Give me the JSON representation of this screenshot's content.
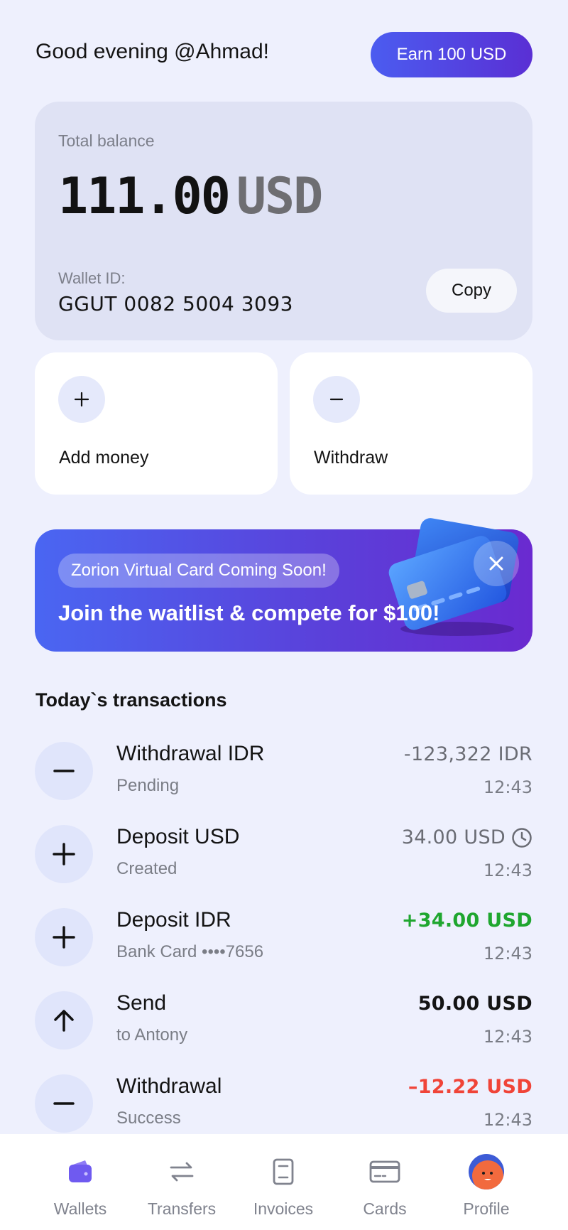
{
  "header": {
    "greeting": "Good evening @Ahmad!",
    "earn_button": "Earn 100 USD"
  },
  "balance": {
    "label": "Total balance",
    "amount": "111.00",
    "currency": "USD",
    "wallet_label": "Wallet ID:",
    "wallet_id": "GGUT 0082 5004 3093",
    "copy_button": "Copy"
  },
  "actions": [
    {
      "label": "Add money",
      "icon": "plus-icon"
    },
    {
      "label": "Withdraw",
      "icon": "minus-icon"
    }
  ],
  "promo": {
    "chip": "Zorion Virtual Card Coming Soon!",
    "title": "Join the waitlist & compete for $100!"
  },
  "transactions_title": "Today`s transactions",
  "transactions": [
    {
      "title": "Withdrawal IDR",
      "subtitle": "Pending",
      "amount": "-123,322 IDR",
      "time": "12:43",
      "icon": "minus-icon",
      "status_color": "neutral"
    },
    {
      "title": "Deposit USD",
      "subtitle": "Created",
      "amount": "34.00 USD",
      "time": "12:43",
      "icon": "plus-icon",
      "status_color": "neutral",
      "status_icon": "clock-icon"
    },
    {
      "title": "Deposit IDR",
      "subtitle": "Bank Card ••••7656",
      "amount": "+34.00 USD",
      "time": "12:43",
      "icon": "plus-icon",
      "status_color": "positive"
    },
    {
      "title": "Send",
      "subtitle": "to Antony",
      "amount": "50.00 USD",
      "time": "12:43",
      "icon": "arrow-up-icon",
      "status_color": "dark"
    },
    {
      "title": "Withdrawal",
      "subtitle": "Success",
      "amount": "–12.22 USD",
      "time": "12:43",
      "icon": "minus-icon",
      "status_color": "negative"
    }
  ],
  "colors": {
    "accent": "#4b5cf0",
    "positive": "#1fa62f",
    "negative": "#f04438",
    "background": "#eef0fd"
  },
  "nav": [
    {
      "label": "Wallets",
      "icon": "wallet-icon",
      "active": true
    },
    {
      "label": "Transfers",
      "icon": "transfer-arrows-icon"
    },
    {
      "label": "Invoices",
      "icon": "invoice-icon"
    },
    {
      "label": "Cards",
      "icon": "card-icon"
    },
    {
      "label": "Profile",
      "icon": "avatar"
    }
  ]
}
